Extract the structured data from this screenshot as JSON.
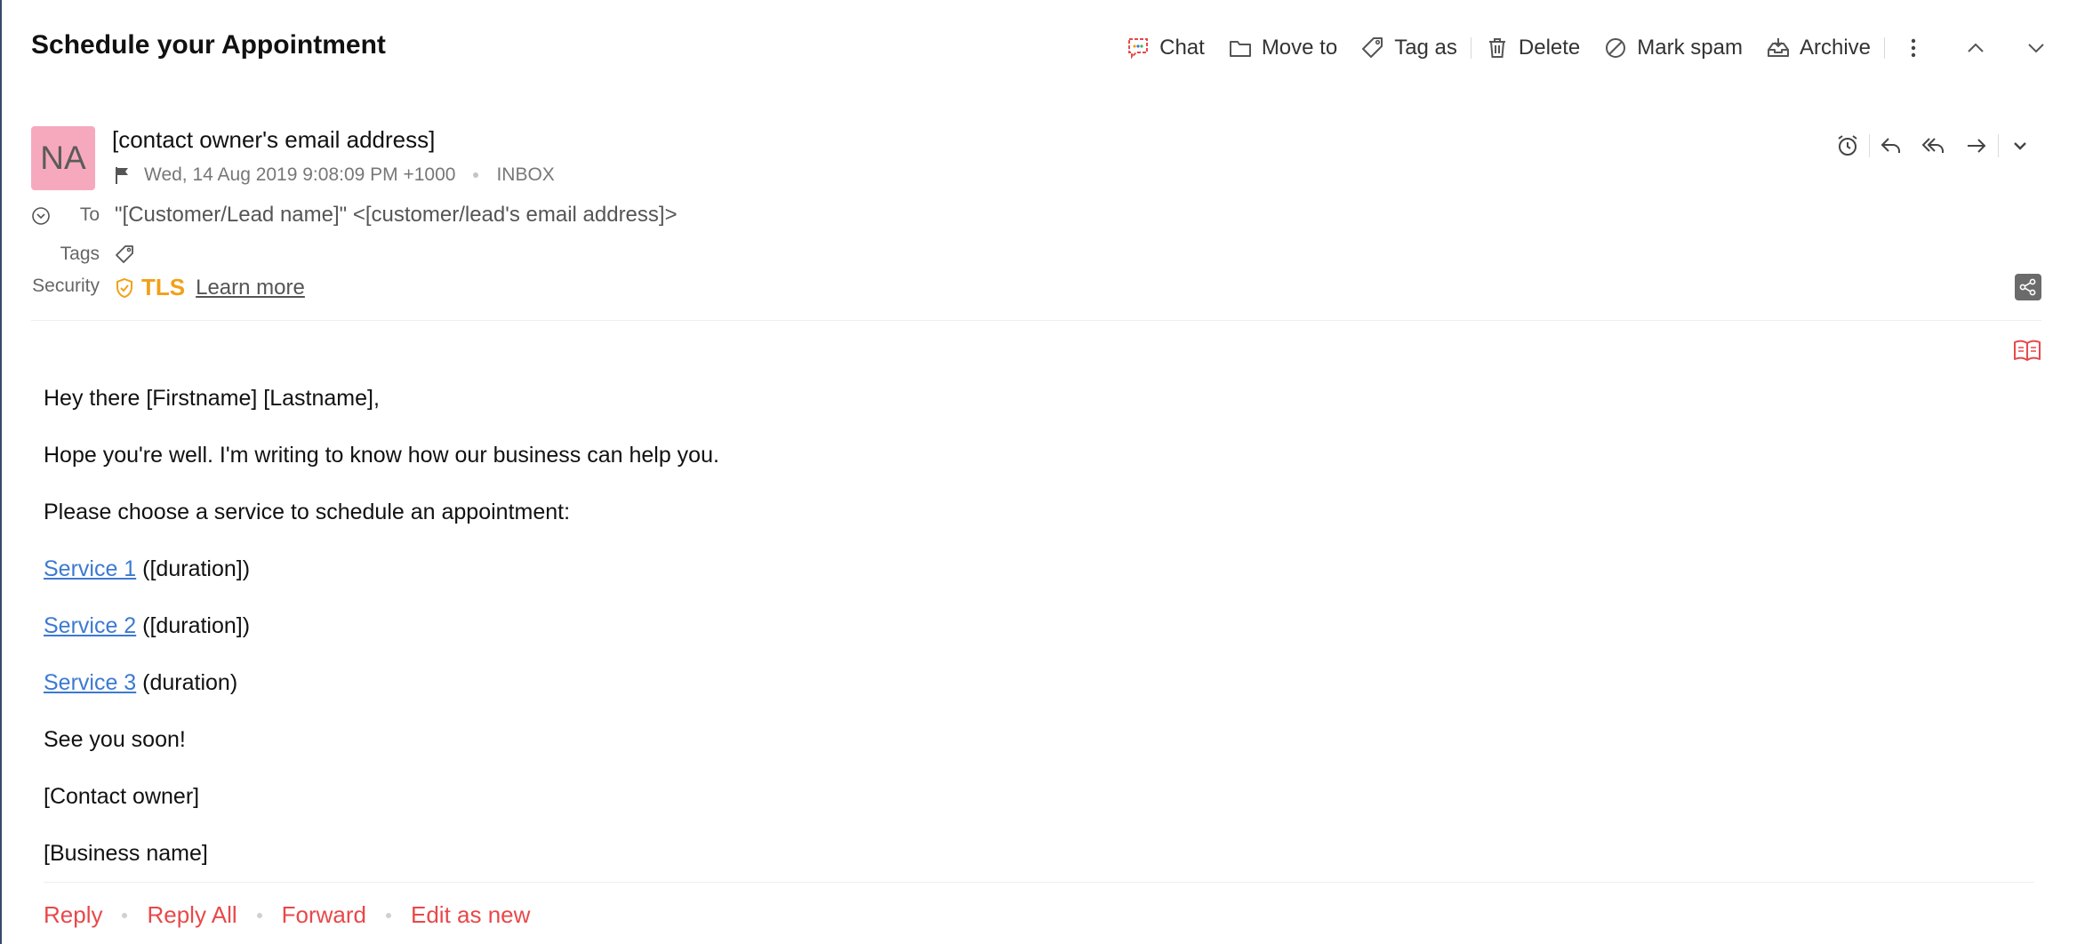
{
  "header": {
    "subject": "Schedule your Appointment",
    "toolbar": {
      "chat": "Chat",
      "move_to": "Move to",
      "tag_as": "Tag as",
      "delete": "Delete",
      "mark_spam": "Mark spam",
      "archive": "Archive"
    }
  },
  "message": {
    "avatar_initials": "NA",
    "avatar_color": "#f6a9bd",
    "from": "[contact owner's email address]",
    "date": "Wed, 14 Aug 2019 9:08:09 PM +1000",
    "folder": "INBOX",
    "to_label": "To",
    "to_value": "\"[Customer/Lead name]\" <[customer/lead's email address]>",
    "tags_label": "Tags",
    "security_label": "Security",
    "security_value": "TLS",
    "learn_more": "Learn more"
  },
  "body": {
    "greeting": "Hey there [Firstname] [Lastname],",
    "intro": "Hope you're well. I'm writing to know how our business can help you.",
    "prompt": "Please choose a service to schedule an appointment:",
    "services": [
      {
        "link": "Service 1",
        "suffix": " ([duration])"
      },
      {
        "link": "Service 2",
        "suffix": " ([duration])"
      },
      {
        "link": "Service 3",
        "suffix": " (duration)"
      }
    ],
    "closing": "See you soon!",
    "signature_name": "[Contact owner]",
    "signature_business": "[Business name]"
  },
  "footer": {
    "reply": "Reply",
    "reply_all": "Reply All",
    "forward": "Forward",
    "edit_as_new": "Edit as new"
  },
  "colors": {
    "accent": "#e8484a",
    "link": "#3c7ad1",
    "tls": "#f2a016"
  }
}
